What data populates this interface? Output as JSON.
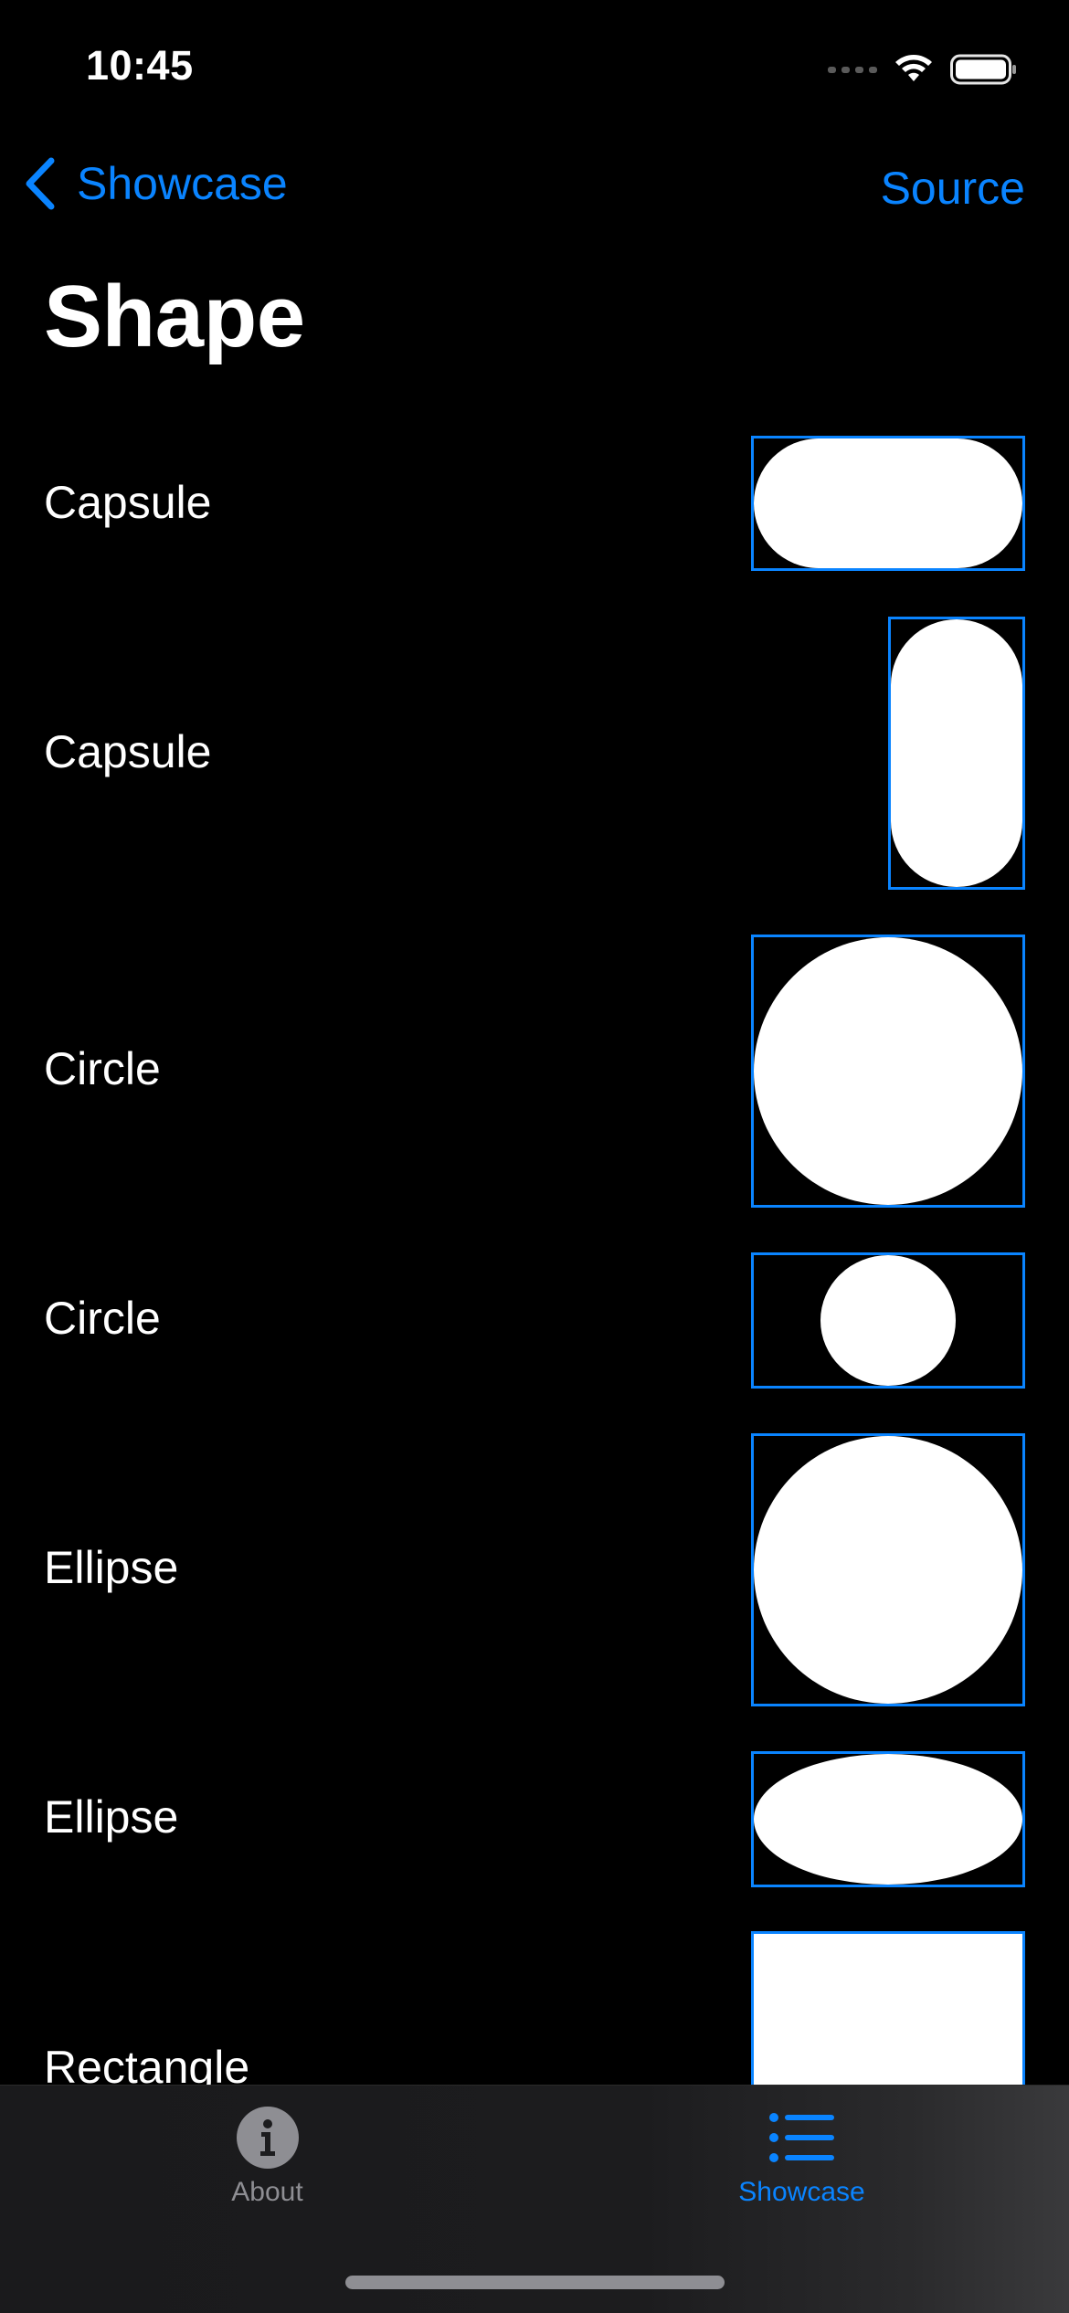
{
  "status_bar": {
    "time": "10:45"
  },
  "nav": {
    "back_label": "Showcase",
    "action_label": "Source",
    "title": "Shape"
  },
  "rows": [
    {
      "label": "Capsule"
    },
    {
      "label": "Capsule"
    },
    {
      "label": "Circle"
    },
    {
      "label": "Circle"
    },
    {
      "label": "Ellipse"
    },
    {
      "label": "Ellipse"
    },
    {
      "label": "Rectangle"
    }
  ],
  "tab_bar": {
    "tabs": [
      {
        "label": "About",
        "icon": "info-circle-icon",
        "selected": false
      },
      {
        "label": "Showcase",
        "icon": "list-bullet-icon",
        "selected": true
      }
    ]
  },
  "colors": {
    "accent": "#0a84ff",
    "background": "#000000",
    "shape_fill": "#ffffff",
    "inactive": "#8e8e93"
  }
}
